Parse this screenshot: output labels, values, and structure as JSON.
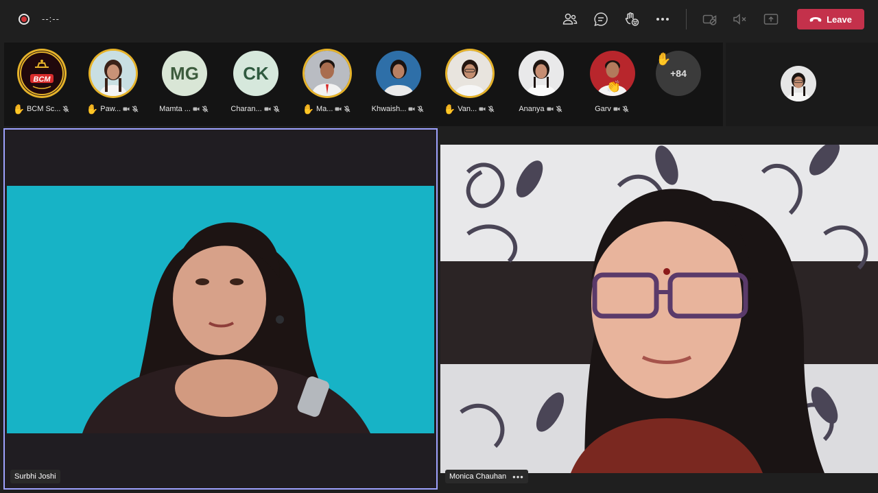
{
  "toolbar": {
    "timer": "--:--",
    "leave_label": "Leave",
    "icons": [
      "participants-icon",
      "chat-icon",
      "reactions-icon",
      "more-actions-icon",
      "camera-off-icon",
      "mic-off-icon",
      "share-icon"
    ]
  },
  "participants": [
    {
      "name": "BCM Sc...",
      "hand_raised": true,
      "avatar": "bcm-logo",
      "ring": true
    },
    {
      "name": "Paw...",
      "hand_raised": true,
      "avatar": "photo",
      "ring": true
    },
    {
      "name": "Mamta ...",
      "hand_raised": false,
      "avatar": "initials",
      "initials": "MG"
    },
    {
      "name": "Charan...",
      "hand_raised": false,
      "avatar": "initials",
      "initials": "CK"
    },
    {
      "name": "Ma...",
      "hand_raised": true,
      "avatar": "photo",
      "ring": true
    },
    {
      "name": "Khwaish...",
      "hand_raised": false,
      "avatar": "photo"
    },
    {
      "name": "Van...",
      "hand_raised": true,
      "avatar": "photo",
      "ring": true
    },
    {
      "name": "Ananya",
      "hand_raised": false,
      "avatar": "photo"
    },
    {
      "name": "Garv",
      "hand_raised": false,
      "avatar": "photo",
      "reaction": "clap"
    }
  ],
  "overflow": {
    "label": "+84"
  },
  "avatar_logo_text": "BCM",
  "tiles": {
    "left_name": "Surbhi Joshi",
    "right_name": "Monica Chauhan"
  },
  "colors": {
    "leave": "#c4314b",
    "active_border": "#9ea2ff",
    "hand": "#f2b12c",
    "video_bg_left": "#17b3c6"
  }
}
